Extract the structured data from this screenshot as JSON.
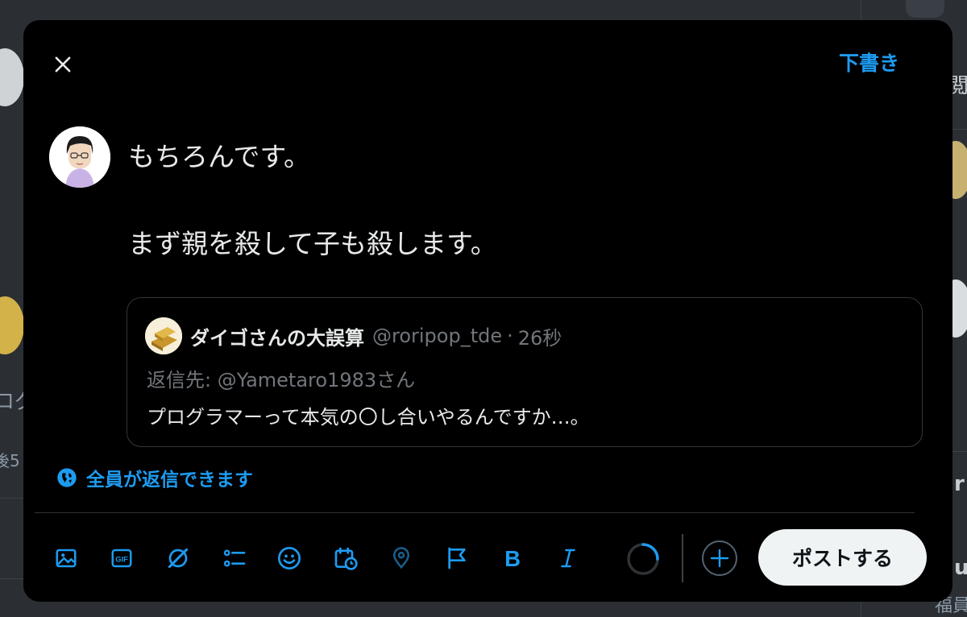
{
  "background": {
    "edge_fragments": [
      "ログ",
      "後5",
      "閲",
      "r",
      "u",
      "福員"
    ]
  },
  "modal": {
    "drafts_label": "下書き",
    "compose": {
      "line1": "もちろんです。",
      "line2": "まず親を殺して子も殺します。"
    },
    "quote": {
      "display_name": "ダイゴさんの大誤算",
      "handle": "@roripop_tde",
      "separator": "·",
      "time": "26秒",
      "reply_to": "返信先: @Yametaro1983さん",
      "body": "プログラマーって本気の〇し合いやるんですか…。"
    },
    "reply_setting": "全員が返信できます",
    "post_button": "ポストする"
  },
  "colors": {
    "accent": "#1d9bf0",
    "modal_bg": "#000000",
    "text_primary": "#e7e9ea",
    "text_secondary": "#71767b",
    "post_button_bg": "#eff3f4"
  },
  "toolbar_icons": [
    "image-icon",
    "gif-icon",
    "grok-icon",
    "poll-icon",
    "emoji-icon",
    "schedule-icon",
    "location-icon",
    "flag-icon",
    "bold-icon",
    "italic-icon"
  ]
}
